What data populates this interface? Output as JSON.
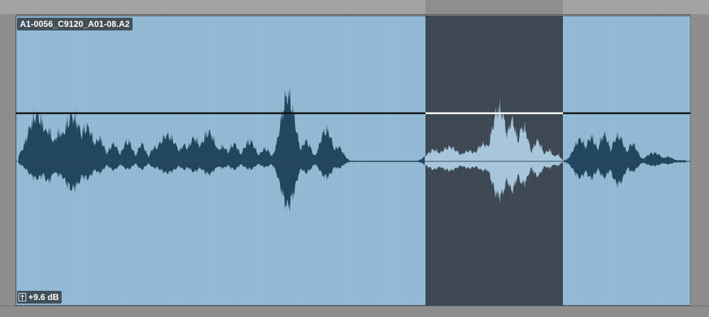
{
  "clip": {
    "name": "A1-0056_C9120_A01-08.A2",
    "gain_label": "+9.6 dB",
    "gain_icon": "clip-gain-fader-icon"
  },
  "colors": {
    "clip_background": "#95bcd7",
    "waveform": "#23465f",
    "selection_background": "#3a4550",
    "selected_waveform": "#a7c6dc",
    "volume_line": "#111111",
    "volume_line_selected": "#ffffff"
  },
  "selection": {
    "present": true
  }
}
